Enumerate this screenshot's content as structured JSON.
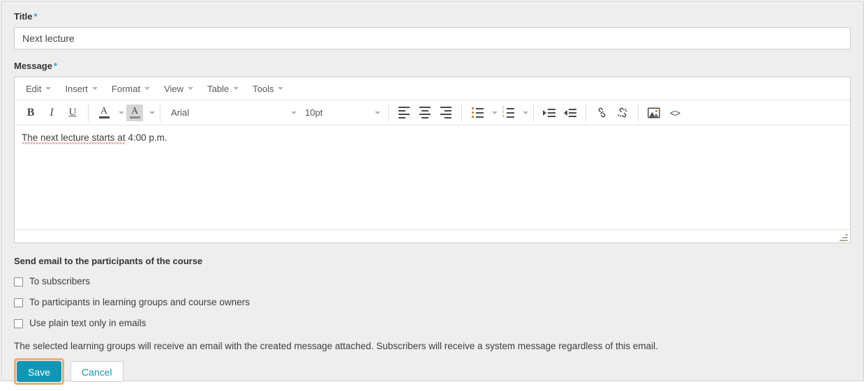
{
  "form": {
    "title_field": {
      "label": "Title",
      "required_marker": "*",
      "value": "Next lecture",
      "placeholder": "Title"
    },
    "message_field": {
      "label": "Message",
      "required_marker": "*",
      "content": "The next lecture starts at 4:00 p.m.",
      "spellchecked_part": "The next lecture starts at",
      "rest_part": " 4:00 p.m."
    }
  },
  "editor": {
    "menubar": [
      {
        "label": "Edit"
      },
      {
        "label": "Insert"
      },
      {
        "label": "Format"
      },
      {
        "label": "View"
      },
      {
        "label": "Table"
      },
      {
        "label": "Tools"
      }
    ],
    "toolbar": {
      "bold": "B",
      "italic": "I",
      "underline": "U",
      "forecolor": "A",
      "backcolor": "A",
      "font_family": "Arial",
      "font_size": "10pt",
      "source_code": "<>"
    }
  },
  "email_section": {
    "title": "Send email to the participants of the course",
    "options": [
      {
        "label": "To subscribers",
        "checked": false
      },
      {
        "label": "To participants in learning groups and course owners",
        "checked": false
      },
      {
        "label": "Use plain text only in emails",
        "checked": false
      }
    ],
    "help_text": "The selected learning groups will receive an email with the created message attached. Subscribers will receive a system message regardless of this email."
  },
  "buttons": {
    "save": "Save",
    "cancel": "Cancel"
  },
  "colors": {
    "accent": "#0d97b5",
    "required_star": "#29a8d0",
    "focus_ring": "#f0ad6e",
    "panel_bg": "#eeeeee"
  }
}
